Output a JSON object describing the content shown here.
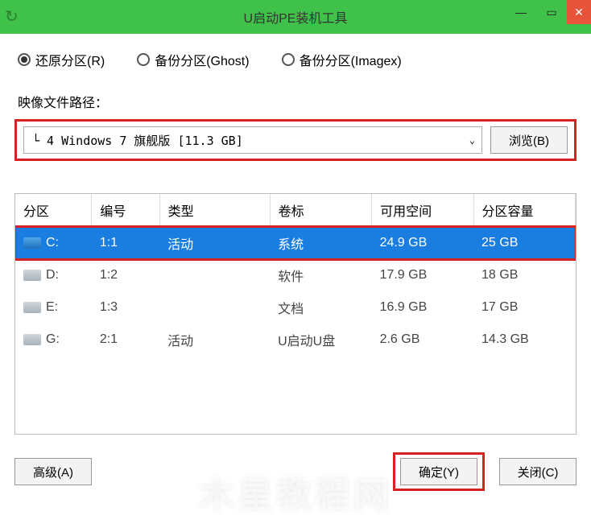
{
  "window": {
    "title": "U启动PE装机工具"
  },
  "modes": {
    "restore": "还原分区(R)",
    "backup_ghost": "备份分区(Ghost)",
    "backup_imagex": "备份分区(Imagex)"
  },
  "image_path": {
    "label": "映像文件路径：",
    "value": "└ 4 Windows 7 旗舰版 [11.3 GB]",
    "browse": "浏览(B)"
  },
  "table": {
    "headers": {
      "partition": "分区",
      "number": "编号",
      "type": "类型",
      "label": "卷标",
      "free": "可用空间",
      "capacity": "分区容量"
    },
    "rows": [
      {
        "drive": "C:",
        "num": "1:1",
        "type": "活动",
        "label": "系统",
        "free": "24.9 GB",
        "cap": "25 GB",
        "selected": true,
        "iconBlue": true
      },
      {
        "drive": "D:",
        "num": "1:2",
        "type": "",
        "label": "软件",
        "free": "17.9 GB",
        "cap": "18 GB",
        "selected": false
      },
      {
        "drive": "E:",
        "num": "1:3",
        "type": "",
        "label": "文档",
        "free": "16.9 GB",
        "cap": "17 GB",
        "selected": false
      },
      {
        "drive": "G:",
        "num": "2:1",
        "type": "活动",
        "label": "U启动U盘",
        "free": "2.6 GB",
        "cap": "14.3 GB",
        "selected": false
      }
    ]
  },
  "buttons": {
    "advanced": "高级(A)",
    "ok": "确定(Y)",
    "close": "关闭(C)"
  },
  "watermark": "木星教程网"
}
